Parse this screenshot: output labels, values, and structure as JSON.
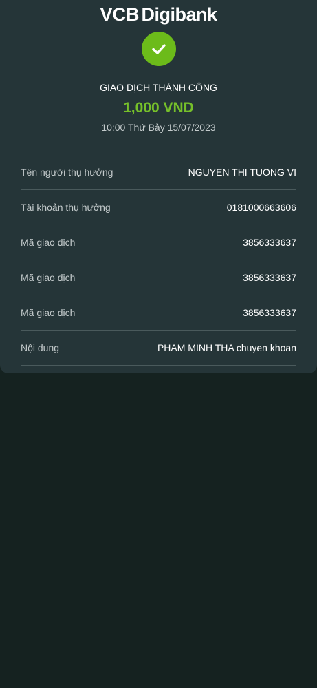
{
  "header": {
    "logo_primary": "VCB",
    "logo_secondary": "Digibank"
  },
  "transaction": {
    "status": "GIAO DỊCH THÀNH CÔNG",
    "amount": "1,000 VND",
    "datetime": "10:00 Thứ Bảy 15/07/2023"
  },
  "details": [
    {
      "label": "Tên người thụ hưởng",
      "value": "NGUYEN THI TUONG VI"
    },
    {
      "label": "Tài khoản thụ hưởng",
      "value": "0181000663606"
    },
    {
      "label": "Mã giao dịch",
      "value": "3856333637"
    },
    {
      "label": "Mã giao dịch",
      "value": "3856333637"
    },
    {
      "label": "Mã giao dịch",
      "value": "3856333637"
    },
    {
      "label": "Nội dung",
      "value": "PHAM MINH THA chuyen khoan"
    }
  ],
  "colors": {
    "accent": "#6cbb1a",
    "amount": "#76c02a",
    "card_bg": "#253538",
    "page_bg": "#152220"
  },
  "icons": {
    "success": "check-circle-icon"
  }
}
